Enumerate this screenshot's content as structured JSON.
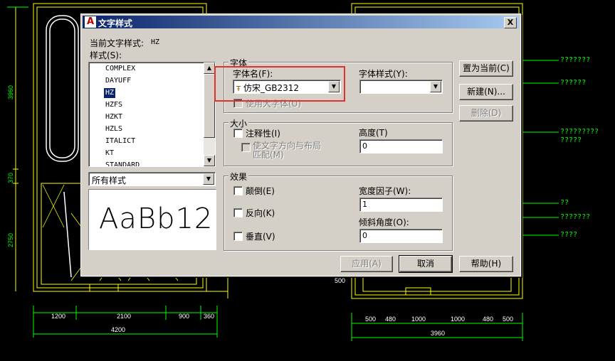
{
  "cad": {
    "right_labels": [
      "???????",
      "??????",
      "?????????",
      "?????",
      "??",
      "???????",
      "????"
    ],
    "dims_bottom_left": [
      "1200",
      "2100",
      "900",
      "360"
    ],
    "dim_total_left": "4200",
    "dims_bottom_right": [
      "500",
      "480",
      "1000",
      "1000",
      "480",
      "500"
    ],
    "dim_total_right": "3960",
    "dims_left_vertical": [
      "3960",
      "370",
      "2750"
    ],
    "dim_mid": "500"
  },
  "dialog": {
    "title": "文字样式",
    "close": "X",
    "current_style_label": "当前文字样式:",
    "current_style_value": "HZ",
    "styles_label": "样式(S):",
    "styles": [
      "COMPLEX",
      "DAYUFF",
      "HZ",
      "HZFS",
      "HZKT",
      "HZLS",
      "ITALICT",
      "KT",
      "STANDARD"
    ],
    "selected_style": "HZ",
    "filter_value": "所有样式",
    "preview_text": "AaBb12",
    "font_group": "字体",
    "font_name_label": "字体名(F):",
    "font_name_value": "仿宋_GB2312",
    "font_style_label": "字体样式(Y):",
    "font_style_value": "",
    "use_bigfont": "使用大字体(U)",
    "size_group": "大小",
    "annotative": "注释性(I)",
    "match_orientation": "使文字方向与布局匹配(M)",
    "height_label": "高度(T)",
    "height_value": "0",
    "effects_group": "效果",
    "upside_down": "颠倒(E)",
    "backwards": "反向(K)",
    "vertical": "垂直(V)",
    "width_factor_label": "宽度因子(W):",
    "width_factor_value": "1",
    "oblique_label": "倾斜角度(O):",
    "oblique_value": "0",
    "btn_set_current": "置为当前(C)",
    "btn_new": "新建(N)...",
    "btn_delete": "删除(D)",
    "btn_apply": "应用(A)",
    "btn_cancel": "取消",
    "btn_help": "帮助(H)"
  },
  "colors": {
    "cad_green": "#00ff00",
    "cad_yellow": "#ffff00",
    "title_start": "#0a246a",
    "highlight": "#e03030"
  }
}
